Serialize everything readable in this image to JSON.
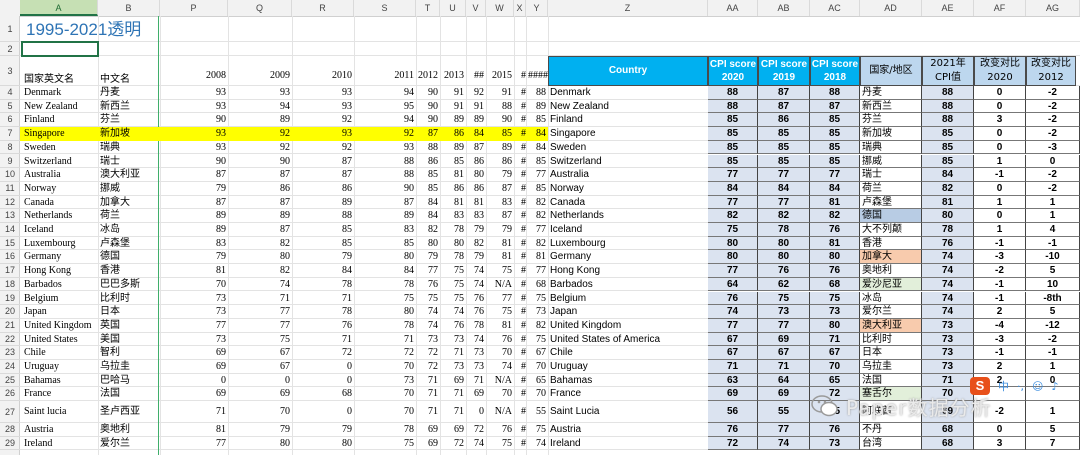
{
  "title": "1995-2021透明",
  "columns": [
    "A",
    "B",
    "P",
    "Q",
    "R",
    "S",
    "T",
    "U",
    "V",
    "W",
    "X",
    "Y",
    "Z",
    "AA",
    "AB",
    "AC",
    "AD",
    "AE",
    "AF",
    "AG"
  ],
  "selected_column": "A",
  "row_numbers": [
    "1",
    "2",
    "3",
    "4",
    "5",
    "6",
    "7",
    "8",
    "9",
    "10",
    "11",
    "12",
    "13",
    "14",
    "15",
    "16",
    "17",
    "18",
    "19",
    "20",
    "21",
    "22",
    "23",
    "24",
    "25",
    "26",
    "27",
    "28",
    "29"
  ],
  "left_headers": {
    "country_en": "国家英文名",
    "country_cn": "中文名",
    "y2008": "2008",
    "y2009": "2009",
    "y2010": "2010",
    "y2011": "2011",
    "y2012": "2012",
    "y2013": "2013",
    "y2014": "##",
    "y2015": "2015",
    "yX": "#",
    "yY": "####"
  },
  "right_headers": {
    "country": "Country",
    "cpi2020": "CPI score 2020",
    "cpi2019": "CPI score 2019",
    "cpi2018": "CPI score 2018",
    "region": "国家/地区",
    "cpi2021": "2021年CPI值",
    "chg2020": "改变对比2020",
    "chg2012": "改变对比2012"
  },
  "rows": [
    {
      "rn": "4",
      "en": "Denmark",
      "cn": "丹麦",
      "p": "93",
      "q": "93",
      "r": "93",
      "s": "94",
      "t": "90",
      "u": "91",
      "v": "92",
      "w": "91",
      "x": "#",
      "y": "88",
      "z": "Denmark",
      "aa": "88",
      "ab": "87",
      "ac": "88",
      "ad": "丹麦",
      "ae": "88",
      "af": "0",
      "ag": "-2"
    },
    {
      "rn": "5",
      "en": "New Zealand",
      "cn": "新西兰",
      "p": "93",
      "q": "94",
      "r": "93",
      "s": "95",
      "t": "90",
      "u": "91",
      "v": "91",
      "w": "88",
      "x": "#",
      "y": "89",
      "z": "New Zealand",
      "aa": "88",
      "ab": "87",
      "ac": "87",
      "ad": "新西兰",
      "ae": "88",
      "af": "0",
      "ag": "-2"
    },
    {
      "rn": "6",
      "en": "Finland",
      "cn": "芬兰",
      "p": "90",
      "q": "89",
      "r": "92",
      "s": "94",
      "t": "90",
      "u": "89",
      "v": "89",
      "w": "90",
      "x": "#",
      "y": "85",
      "z": "Finland",
      "aa": "85",
      "ab": "86",
      "ac": "85",
      "ad": "芬兰",
      "ae": "88",
      "af": "3",
      "ag": "-2"
    },
    {
      "rn": "7",
      "en": "Singapore",
      "cn": "新加坡",
      "p": "93",
      "q": "92",
      "r": "93",
      "s": "92",
      "t": "87",
      "u": "86",
      "v": "84",
      "w": "85",
      "x": "#",
      "y": "84",
      "z": "Singapore",
      "aa": "85",
      "ab": "85",
      "ac": "85",
      "ad": "新加坡",
      "ae": "85",
      "af": "0",
      "ag": "-2",
      "hl": true
    },
    {
      "rn": "8",
      "en": "Sweden",
      "cn": "瑞典",
      "p": "93",
      "q": "92",
      "r": "92",
      "s": "93",
      "t": "88",
      "u": "89",
      "v": "87",
      "w": "89",
      "x": "#",
      "y": "84",
      "z": "Sweden",
      "aa": "85",
      "ab": "85",
      "ac": "85",
      "ad": "瑞典",
      "ae": "85",
      "af": "0",
      "ag": "-3"
    },
    {
      "rn": "9",
      "en": "Switzerland",
      "cn": "瑞士",
      "p": "90",
      "q": "90",
      "r": "87",
      "s": "88",
      "t": "86",
      "u": "85",
      "v": "86",
      "w": "86",
      "x": "#",
      "y": "85",
      "z": "Switzerland",
      "aa": "85",
      "ab": "85",
      "ac": "85",
      "ad": "挪威",
      "ae": "85",
      "af": "1",
      "ag": "0"
    },
    {
      "rn": "10",
      "en": "Australia",
      "cn": "澳大利亚",
      "p": "87",
      "q": "87",
      "r": "87",
      "s": "88",
      "t": "85",
      "u": "81",
      "v": "80",
      "w": "79",
      "x": "#",
      "y": "77",
      "z": "Australia",
      "aa": "77",
      "ab": "77",
      "ac": "77",
      "ad": "瑞士",
      "ae": "84",
      "af": "-1",
      "ag": "-2"
    },
    {
      "rn": "11",
      "en": "Norway",
      "cn": "挪威",
      "p": "79",
      "q": "86",
      "r": "86",
      "s": "90",
      "t": "85",
      "u": "86",
      "v": "86",
      "w": "87",
      "x": "#",
      "y": "85",
      "z": "Norway",
      "aa": "84",
      "ab": "84",
      "ac": "84",
      "ad": "荷兰",
      "ae": "82",
      "af": "0",
      "ag": "-2"
    },
    {
      "rn": "12",
      "en": "Canada",
      "cn": "加拿大",
      "p": "87",
      "q": "87",
      "r": "89",
      "s": "87",
      "t": "84",
      "u": "81",
      "v": "81",
      "w": "83",
      "x": "#",
      "y": "82",
      "z": "Canada",
      "aa": "77",
      "ab": "77",
      "ac": "81",
      "ad": "卢森堡",
      "ae": "81",
      "af": "1",
      "ag": "1"
    },
    {
      "rn": "13",
      "en": "Netherlands",
      "cn": "荷兰",
      "p": "89",
      "q": "89",
      "r": "88",
      "s": "89",
      "t": "84",
      "u": "83",
      "v": "83",
      "w": "87",
      "x": "#",
      "y": "82",
      "z": "Netherlands",
      "aa": "82",
      "ab": "82",
      "ac": "82",
      "ad": "德国",
      "ae": "80",
      "af": "0",
      "ag": "1"
    },
    {
      "rn": "14",
      "en": "Iceland",
      "cn": "冰岛",
      "p": "89",
      "q": "87",
      "r": "85",
      "s": "83",
      "t": "82",
      "u": "78",
      "v": "79",
      "w": "79",
      "x": "#",
      "y": "77",
      "z": "Iceland",
      "aa": "75",
      "ab": "78",
      "ac": "76",
      "ad": "大不列颠",
      "ae": "78",
      "af": "1",
      "ag": "4"
    },
    {
      "rn": "15",
      "en": "Luxembourg",
      "cn": "卢森堡",
      "p": "83",
      "q": "82",
      "r": "85",
      "s": "85",
      "t": "80",
      "u": "80",
      "v": "82",
      "w": "81",
      "x": "#",
      "y": "82",
      "z": "Luxembourg",
      "aa": "80",
      "ab": "80",
      "ac": "81",
      "ad": "香港",
      "ae": "76",
      "af": "-1",
      "ag": "-1"
    },
    {
      "rn": "16",
      "en": "Germany",
      "cn": "德国",
      "p": "79",
      "q": "80",
      "r": "79",
      "s": "80",
      "t": "79",
      "u": "78",
      "v": "79",
      "w": "81",
      "x": "#",
      "y": "81",
      "z": "Germany",
      "aa": "80",
      "ab": "80",
      "ac": "80",
      "ad": "加拿大",
      "ae": "74",
      "af": "-3",
      "ag": "-10"
    },
    {
      "rn": "17",
      "en": "Hong Kong",
      "cn": "香港",
      "p": "81",
      "q": "82",
      "r": "84",
      "s": "84",
      "t": "77",
      "u": "75",
      "v": "74",
      "w": "75",
      "x": "#",
      "y": "77",
      "z": "Hong Kong",
      "aa": "77",
      "ab": "76",
      "ac": "76",
      "ad": "奥地利",
      "ae": "74",
      "af": "-2",
      "ag": "5"
    },
    {
      "rn": "18",
      "en": "Barbados",
      "cn": "巴巴多斯",
      "p": "70",
      "q": "74",
      "r": "78",
      "s": "78",
      "t": "76",
      "u": "75",
      "v": "74",
      "w": "N/A",
      "x": "#",
      "y": "68",
      "z": "Barbados",
      "aa": "64",
      "ab": "62",
      "ac": "68",
      "ad": "爱沙尼亚",
      "ae": "74",
      "af": "-1",
      "ag": "10"
    },
    {
      "rn": "19",
      "en": "Belgium",
      "cn": "比利时",
      "p": "73",
      "q": "71",
      "r": "71",
      "s": "75",
      "t": "75",
      "u": "75",
      "v": "76",
      "w": "77",
      "x": "#",
      "y": "75",
      "z": "Belgium",
      "aa": "76",
      "ab": "75",
      "ac": "75",
      "ad": "冰岛",
      "ae": "74",
      "af": "-1",
      "ag": "-8th"
    },
    {
      "rn": "20",
      "en": "Japan",
      "cn": "日本",
      "p": "73",
      "q": "77",
      "r": "78",
      "s": "80",
      "t": "74",
      "u": "74",
      "v": "76",
      "w": "75",
      "x": "#",
      "y": "73",
      "z": "Japan",
      "aa": "74",
      "ab": "73",
      "ac": "73",
      "ad": "爱尔兰",
      "ae": "74",
      "af": "2",
      "ag": "5"
    },
    {
      "rn": "21",
      "en": "United Kingdom",
      "cn": "英国",
      "p": "77",
      "q": "77",
      "r": "76",
      "s": "78",
      "t": "74",
      "u": "76",
      "v": "78",
      "w": "81",
      "x": "#",
      "y": "82",
      "z": "United Kingdom",
      "aa": "77",
      "ab": "77",
      "ac": "80",
      "ad": "澳大利亚",
      "ae": "73",
      "af": "-4",
      "ag": "-12"
    },
    {
      "rn": "22",
      "en": "United States",
      "cn": "美国",
      "p": "73",
      "q": "75",
      "r": "71",
      "s": "71",
      "t": "73",
      "u": "73",
      "v": "74",
      "w": "76",
      "x": "#",
      "y": "75",
      "z": "United States of America",
      "aa": "67",
      "ab": "69",
      "ac": "71",
      "ad": "比利时",
      "ae": "73",
      "af": "-3",
      "ag": "-2"
    },
    {
      "rn": "23",
      "en": "Chile",
      "cn": "智利",
      "p": "69",
      "q": "67",
      "r": "72",
      "s": "72",
      "t": "72",
      "u": "71",
      "v": "73",
      "w": "70",
      "x": "#",
      "y": "67",
      "z": "Chile",
      "aa": "67",
      "ab": "67",
      "ac": "67",
      "ad": "日本",
      "ae": "73",
      "af": "-1",
      "ag": "-1"
    },
    {
      "rn": "24",
      "en": "Uruguay",
      "cn": "乌拉圭",
      "p": "69",
      "q": "67",
      "r": "0",
      "s": "70",
      "t": "72",
      "u": "73",
      "v": "73",
      "w": "74",
      "x": "#",
      "y": "70",
      "z": "Uruguay",
      "aa": "71",
      "ab": "71",
      "ac": "70",
      "ad": "乌拉圭",
      "ae": "73",
      "af": "2",
      "ag": "1"
    },
    {
      "rn": "25",
      "en": "Bahamas",
      "cn": "巴哈马",
      "p": "0",
      "q": "0",
      "r": "0",
      "s": "73",
      "t": "71",
      "u": "69",
      "v": "71",
      "w": "N/A",
      "x": "#",
      "y": "65",
      "z": "Bahamas",
      "aa": "63",
      "ab": "64",
      "ac": "65",
      "ad": "法国",
      "ae": "71",
      "af": "2",
      "ag": "0"
    },
    {
      "rn": "26",
      "en": "France",
      "cn": "法国",
      "p": "69",
      "q": "69",
      "r": "68",
      "s": "70",
      "t": "71",
      "u": "71",
      "v": "69",
      "w": "70",
      "x": "#",
      "y": "70",
      "z": "France",
      "aa": "69",
      "ab": "69",
      "ac": "72",
      "ad": "塞舌尔",
      "ae": "70",
      "af": "",
      "ag": ""
    },
    {
      "rn": "27",
      "en": "Saint lucia",
      "cn": "圣卢西亚",
      "p": "71",
      "q": "70",
      "r": "0",
      "s": "70",
      "t": "71",
      "u": "71",
      "v": "0",
      "w": "N/A",
      "x": "#",
      "y": "55",
      "z": "Saint Lucia",
      "aa": "56",
      "ab": "55",
      "ac": "55",
      "ad": "阿联酋",
      "ae": "69",
      "af": "-2",
      "ag": "1"
    },
    {
      "rn": "28",
      "en": "Austria",
      "cn": "奥地利",
      "p": "81",
      "q": "79",
      "r": "79",
      "s": "78",
      "t": "69",
      "u": "69",
      "v": "72",
      "w": "76",
      "x": "#",
      "y": "75",
      "z": "Austria",
      "aa": "76",
      "ab": "77",
      "ac": "76",
      "ad": "不丹",
      "ae": "68",
      "af": "0",
      "ag": "5"
    },
    {
      "rn": "29",
      "en": "Ireland",
      "cn": "爱尔兰",
      "p": "77",
      "q": "80",
      "r": "80",
      "s": "75",
      "t": "69",
      "u": "72",
      "v": "74",
      "w": "75",
      "x": "#",
      "y": "74",
      "z": "Ireland",
      "aa": "72",
      "ab": "74",
      "ac": "73",
      "ad": "台湾",
      "ae": "68",
      "af": "3",
      "ag": "7"
    }
  ],
  "region_fills": {
    "德国": "#b8cce4",
    "加拿大": "#f8cbad",
    "爱沙尼亚": "#e2efda",
    "澳大利亚": "#f8cbad",
    "塞舌尔": "#e2efda"
  },
  "watermark": "Paper数据分析",
  "ime_label": "S",
  "ime_glyphs": [
    "中",
    "·,",
    "☺",
    "♪"
  ]
}
